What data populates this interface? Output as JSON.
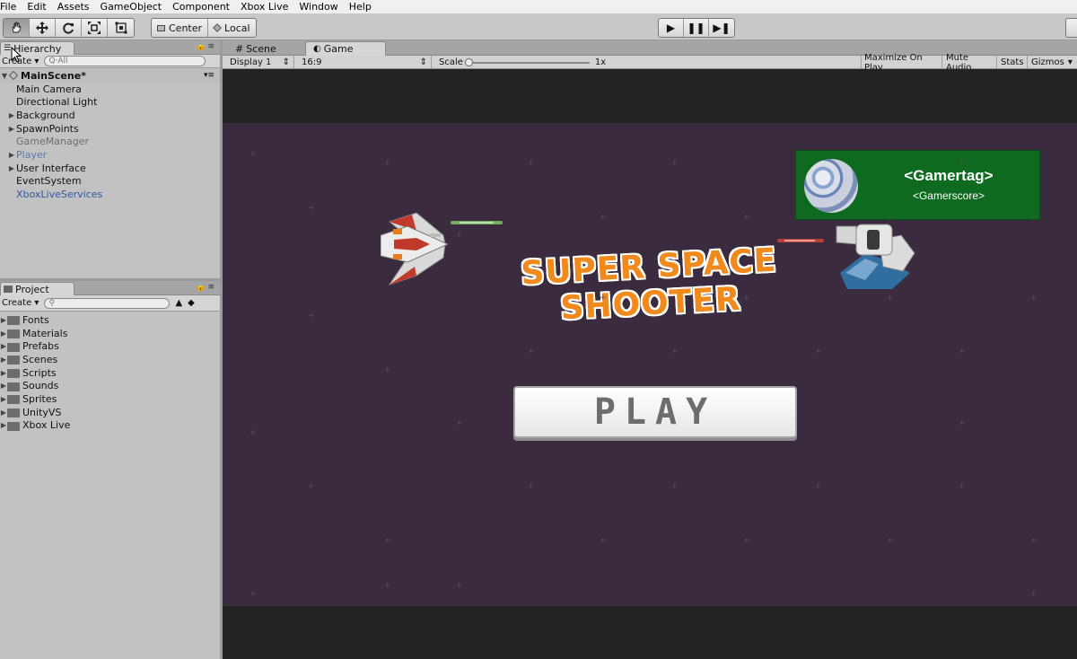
{
  "menu": [
    "File",
    "Edit",
    "Assets",
    "GameObject",
    "Component",
    "Xbox Live",
    "Window",
    "Help"
  ],
  "toolbar": {
    "transform_tools": [
      "hand-icon",
      "move-icon",
      "rotate-icon",
      "scale-icon",
      "rect-icon"
    ],
    "pivot": "Center",
    "space": "Local",
    "playback": [
      "play-icon",
      "pause-icon",
      "step-icon"
    ]
  },
  "hierarchy": {
    "tab_label": "Hierarchy",
    "create_label": "Create",
    "search_placeholder": "Q·All",
    "scene_name": "MainScene*",
    "items": [
      {
        "label": "Main Camera",
        "expand": false,
        "style": "normal"
      },
      {
        "label": "Directional Light",
        "expand": false,
        "style": "normal"
      },
      {
        "label": "Background",
        "expand": true,
        "style": "normal"
      },
      {
        "label": "SpawnPoints",
        "expand": true,
        "style": "normal"
      },
      {
        "label": "GameManager",
        "expand": false,
        "style": "gray"
      },
      {
        "label": "Player",
        "expand": true,
        "style": "lightblue"
      },
      {
        "label": "User Interface",
        "expand": true,
        "style": "normal"
      },
      {
        "label": "EventSystem",
        "expand": false,
        "style": "normal"
      },
      {
        "label": "XboxLiveServices",
        "expand": false,
        "style": "blue"
      }
    ]
  },
  "project": {
    "tab_label": "Project",
    "create_label": "Create",
    "folders": [
      "Fonts",
      "Materials",
      "Prefabs",
      "Scenes",
      "Scripts",
      "Sounds",
      "Sprites",
      "UnityVS",
      "Xbox Live"
    ]
  },
  "game_view": {
    "scene_tab": "Scene",
    "game_tab": "Game",
    "display": "Display 1",
    "aspect": "16:9",
    "scale_label": "Scale",
    "scale_value": "1x",
    "toggles": [
      "Maximize On Play",
      "Mute Audio",
      "Stats",
      "Gizmos"
    ]
  },
  "game": {
    "title": "SUPER SPACE SHOOTER",
    "play_label": "PLAY",
    "gamertag": "<Gamertag>",
    "gamerscore": "<Gamerscore>",
    "colors": {
      "bg": "#3b2b3e",
      "title": "#f08a1c",
      "panel": "#0e6a1e"
    }
  }
}
